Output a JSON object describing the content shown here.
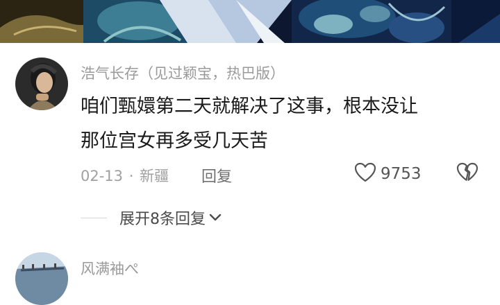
{
  "comments": [
    {
      "username": "浩气长存（见过颖宝，热巴版）",
      "text_lines": [
        "咱们甄嬛第二天就解决了这事，根本没让",
        "那位宫女再多受几天苦"
      ],
      "date": "02-13",
      "separator": "·",
      "location": "新疆",
      "reply_label": "回复",
      "like_count": "9753",
      "expand_replies_label": "展开8条回复"
    },
    {
      "username": "风满袖ぺ"
    }
  ],
  "icons": {
    "like": "heart-outline-icon",
    "dislike": "broken-heart-icon",
    "expand": "chevron-down-icon"
  },
  "colors": {
    "username": "#9a9a9a",
    "comment_text": "#1a1a1a",
    "meta": "#a0a0a0",
    "video_background": "#0e1730"
  }
}
